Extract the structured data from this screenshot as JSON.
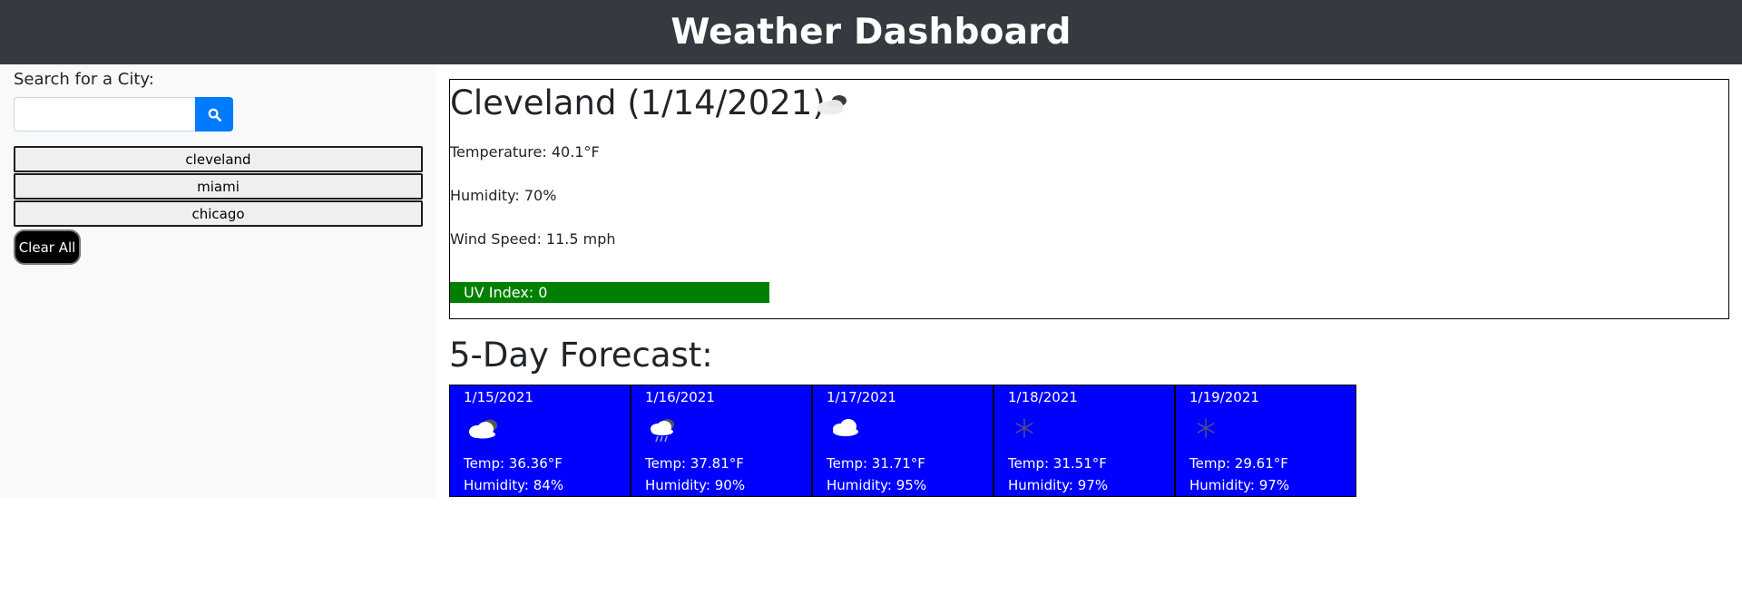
{
  "header": {
    "title": "Weather Dashboard"
  },
  "sidebar": {
    "search_label": "Search for a City:",
    "search_value": "",
    "search_icon": "search-icon",
    "history": [
      "cleveland",
      "miami",
      "chicago"
    ],
    "clear_label": "Clear All"
  },
  "current": {
    "title": "Cleveland (1/14/2021)",
    "icon": "cloudy-icon",
    "temperature": "Temperature: 40.1°F",
    "humidity": "Humidity: 70%",
    "wind": "Wind Speed: 11.5 mph",
    "uv": "UV Index: 0",
    "uv_color": "#008000"
  },
  "forecast": {
    "title": "5-Day Forecast:",
    "card_color": "#0000ff",
    "days": [
      {
        "date": "1/15/2021",
        "icon": "cloudy-icon",
        "temp": "Temp: 36.36°F",
        "humidity": "Humidity: 84%"
      },
      {
        "date": "1/16/2021",
        "icon": "rain-cloud-icon",
        "temp": "Temp: 37.81°F",
        "humidity": "Humidity: 90%"
      },
      {
        "date": "1/17/2021",
        "icon": "cloud-icon",
        "temp": "Temp: 31.71°F",
        "humidity": "Humidity: 95%"
      },
      {
        "date": "1/18/2021",
        "icon": "snowflake-icon",
        "temp": "Temp: 31.51°F",
        "humidity": "Humidity: 97%"
      },
      {
        "date": "1/19/2021",
        "icon": "snowflake-icon",
        "temp": "Temp: 29.61°F",
        "humidity": "Humidity: 97%"
      }
    ]
  }
}
